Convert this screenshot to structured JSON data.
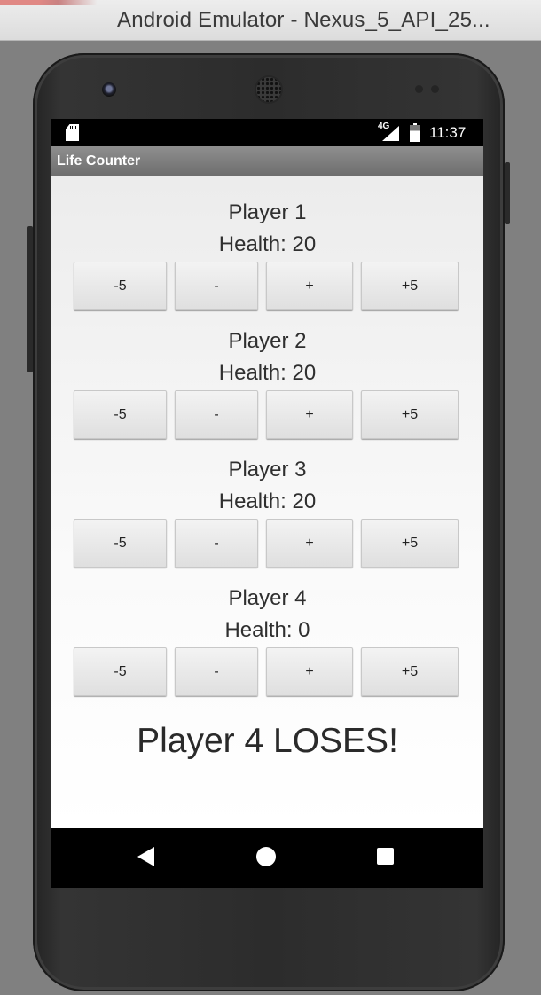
{
  "window": {
    "title": "Android Emulator - Nexus_5_API_25..."
  },
  "status_bar": {
    "network": "4G",
    "time": "11:37"
  },
  "app": {
    "title": "Life Counter"
  },
  "players": [
    {
      "name": "Player 1",
      "health_label": "Health:",
      "health": "20"
    },
    {
      "name": "Player 2",
      "health_label": "Health:",
      "health": "20"
    },
    {
      "name": "Player 3",
      "health_label": "Health:",
      "health": "20"
    },
    {
      "name": "Player 4",
      "health_label": "Health:",
      "health": "0"
    }
  ],
  "buttons": {
    "minus5": "-5",
    "minus1": "-",
    "plus1": "+",
    "plus5": "+5"
  },
  "result": "Player 4 LOSES!",
  "icons": {
    "sd_card": "sd-card-icon",
    "signal": "signal-icon",
    "battery": "battery-icon",
    "back": "back-icon",
    "home": "home-icon",
    "recents": "recents-icon"
  },
  "colors": {
    "action_bar": "#7e7e7e",
    "background": "#f2f2f2",
    "button": "#e6e6e6"
  }
}
